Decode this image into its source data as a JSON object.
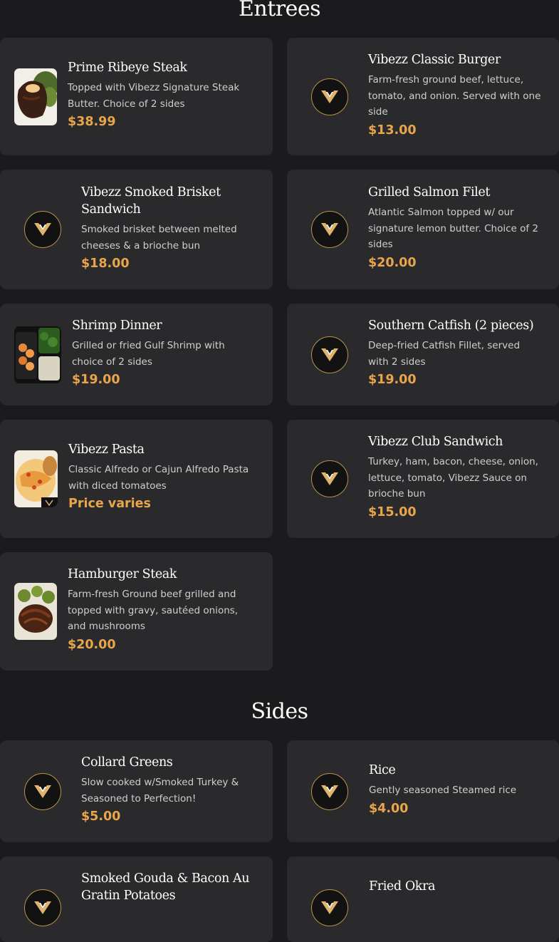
{
  "sections": [
    {
      "title": "Entrees"
    },
    {
      "title": "Sides"
    }
  ],
  "entrees": [
    {
      "name": "Prime Ribeye Steak",
      "desc": "Topped with Vibezz Signature Steak Butter. Choice of 2 sides",
      "price": "$38.99",
      "icon": "ribeye-photo"
    },
    {
      "name": "Vibezz Classic Burger",
      "desc": "Farm-fresh ground beef, lettuce, tomato, and onion. Served with one side",
      "price": "$13.00",
      "icon": "vibezz-logo-icon"
    },
    {
      "name": "Vibezz Smoked Brisket Sandwich",
      "desc": "Smoked brisket between melted cheeses & a brioche bun",
      "price": "$18.00",
      "icon": "vibezz-logo-icon"
    },
    {
      "name": "Grilled Salmon Filet",
      "desc": "Atlantic Salmon topped w/ our signature lemon butter. Choice of 2 sides",
      "price": "$20.00",
      "icon": "vibezz-logo-icon"
    },
    {
      "name": "Shrimp Dinner",
      "desc": "Grilled or fried Gulf Shrimp with choice of 2 sides",
      "price": "$19.00",
      "icon": "shrimp-photo"
    },
    {
      "name": "Southern Catfish (2 pieces)",
      "desc": "Deep-fried Catfish Fillet, served with 2 sides",
      "price": "$19.00",
      "icon": "vibezz-logo-icon"
    },
    {
      "name": "Vibezz Pasta",
      "desc": "Classic Alfredo or Cajun Alfredo Pasta with diced tomatoes",
      "price": "Price varies",
      "icon": "pasta-photo"
    },
    {
      "name": "Vibezz Club Sandwich",
      "desc": "Turkey, ham, bacon, cheese, onion, lettuce, tomato, Vibezz Sauce on brioche bun",
      "price": "$15.00",
      "icon": "vibezz-logo-icon"
    },
    {
      "name": "Hamburger Steak",
      "desc": "Farm-fresh Ground beef grilled and topped with gravy, sautéed onions, and mushrooms",
      "price": "$20.00",
      "icon": "hamburger-steak-photo"
    }
  ],
  "sides": [
    {
      "name": "Collard Greens",
      "desc": "Slow cooked w/Smoked Turkey & Seasoned to Perfection!",
      "price": "$5.00",
      "icon": "vibezz-logo-icon"
    },
    {
      "name": "Rice",
      "desc": "Gently seasoned Steamed rice",
      "price": "$4.00",
      "icon": "vibezz-logo-icon"
    },
    {
      "name": "Smoked Gouda & Bacon Au Gratin Potatoes",
      "desc": "",
      "price": "",
      "icon": "vibezz-logo-icon"
    },
    {
      "name": "Fried Okra",
      "desc": "",
      "price": "",
      "icon": "vibezz-logo-icon"
    }
  ],
  "colors": {
    "background": "#1b1b1d",
    "card": "#2a2a2c",
    "price": "#e8a54b",
    "logo_ring": "#b8924a"
  }
}
